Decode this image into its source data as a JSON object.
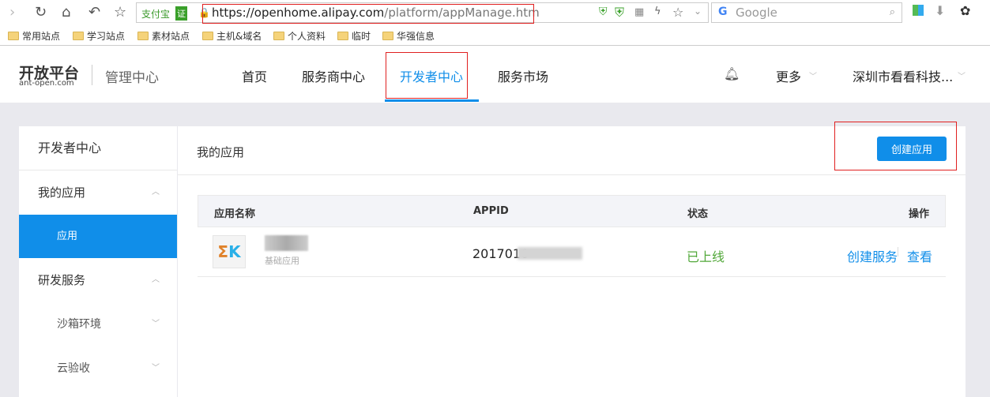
{
  "browser": {
    "url_badge": "支付宝",
    "cert_badge": "证",
    "url_host": "https://openhome.alipay.com",
    "url_path": "/platform/appManage.htm",
    "search_placeholder": "Google",
    "bookmarks": [
      "常用站点",
      "学习站点",
      "素材站点",
      "主机&域名",
      "个人资料",
      "临时",
      "华强信息"
    ]
  },
  "header": {
    "logo": "开放平台",
    "logo_sub": "ant-open.com",
    "section": "管理中心",
    "nav": [
      "首页",
      "服务商中心",
      "开发者中心",
      "服务市场"
    ],
    "more": "更多",
    "account": "深圳市看看科技..."
  },
  "sidebar": {
    "title": "开发者中心",
    "groups": [
      {
        "label": "我的应用",
        "items": [
          "应用"
        ]
      },
      {
        "label": "研发服务",
        "items": [
          "沙箱环境",
          "云验收"
        ]
      }
    ]
  },
  "main": {
    "title": "我的应用",
    "create_button": "创建应用",
    "table": {
      "headers": [
        "应用名称",
        "APPID",
        "状态",
        "操作"
      ],
      "rows": [
        {
          "name_sub": "基础应用",
          "appid": "2017010",
          "status": "已上线",
          "actions": [
            "创建服务",
            "查看"
          ]
        }
      ]
    }
  },
  "colors": {
    "accent": "#108ee9",
    "success": "#52a83a"
  }
}
